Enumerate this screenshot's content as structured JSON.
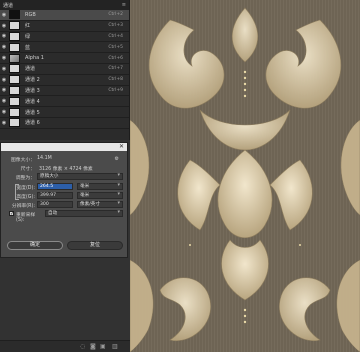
{
  "channels": {
    "title": "通道",
    "menu_glyph": "≡",
    "rows": [
      {
        "name": "RGB",
        "shortcut": "Ctrl+2",
        "thumb": "dark"
      },
      {
        "name": "红",
        "shortcut": "Ctrl+3",
        "thumb": "light"
      },
      {
        "name": "绿",
        "shortcut": "Ctrl+4",
        "thumb": "light"
      },
      {
        "name": "蓝",
        "shortcut": "Ctrl+5",
        "thumb": "light"
      },
      {
        "name": "Alpha 1",
        "shortcut": "Ctrl+6",
        "thumb": "mid"
      },
      {
        "name": "通道",
        "shortcut": "Ctrl+7",
        "thumb": "light"
      },
      {
        "name": "通道 2",
        "shortcut": "Ctrl+8",
        "thumb": "light"
      },
      {
        "name": "通道 3",
        "shortcut": "Ctrl+9",
        "thumb": "light"
      },
      {
        "name": "通道 4",
        "shortcut": "",
        "thumb": "light"
      },
      {
        "name": "通道 5",
        "shortcut": "",
        "thumb": "light"
      },
      {
        "name": "通道 6",
        "shortcut": "",
        "thumb": "light"
      }
    ]
  },
  "dialog": {
    "image_size_label": "图像大小：",
    "image_size_value": "14.1M",
    "dimensions_label": "尺寸：",
    "dimensions_value": "3126 像素 × 4724 像素",
    "fit_label": "调整为：",
    "fit_value": "原稿大小",
    "width_label": "宽度(D):",
    "width_value": "264.5",
    "width_unit": "毫米",
    "height_label": "高度(G):",
    "height_value": "399.97",
    "height_unit": "毫米",
    "resolution_label": "分辨率(R):",
    "resolution_value": "300",
    "resolution_unit": "像素/英寸",
    "resample_label": "重新采样(S):",
    "resample_value": "自动",
    "ok_label": "确定",
    "cancel_label": "复位",
    "close_glyph": "✕",
    "gear_glyph": "⚙",
    "check_glyph": "✓"
  },
  "bottombar": {
    "icons": [
      "dotted-circle-icon",
      "mask-icon",
      "new-channel-icon",
      "delete-icon"
    ]
  },
  "colors": {
    "panel": "#2b2b2b",
    "dialog": "#4b4b4b",
    "highlight": "#2c5ea8",
    "wallpaper_base": "#6b6152",
    "wallpaper_ornament": "#d8c9a8"
  }
}
